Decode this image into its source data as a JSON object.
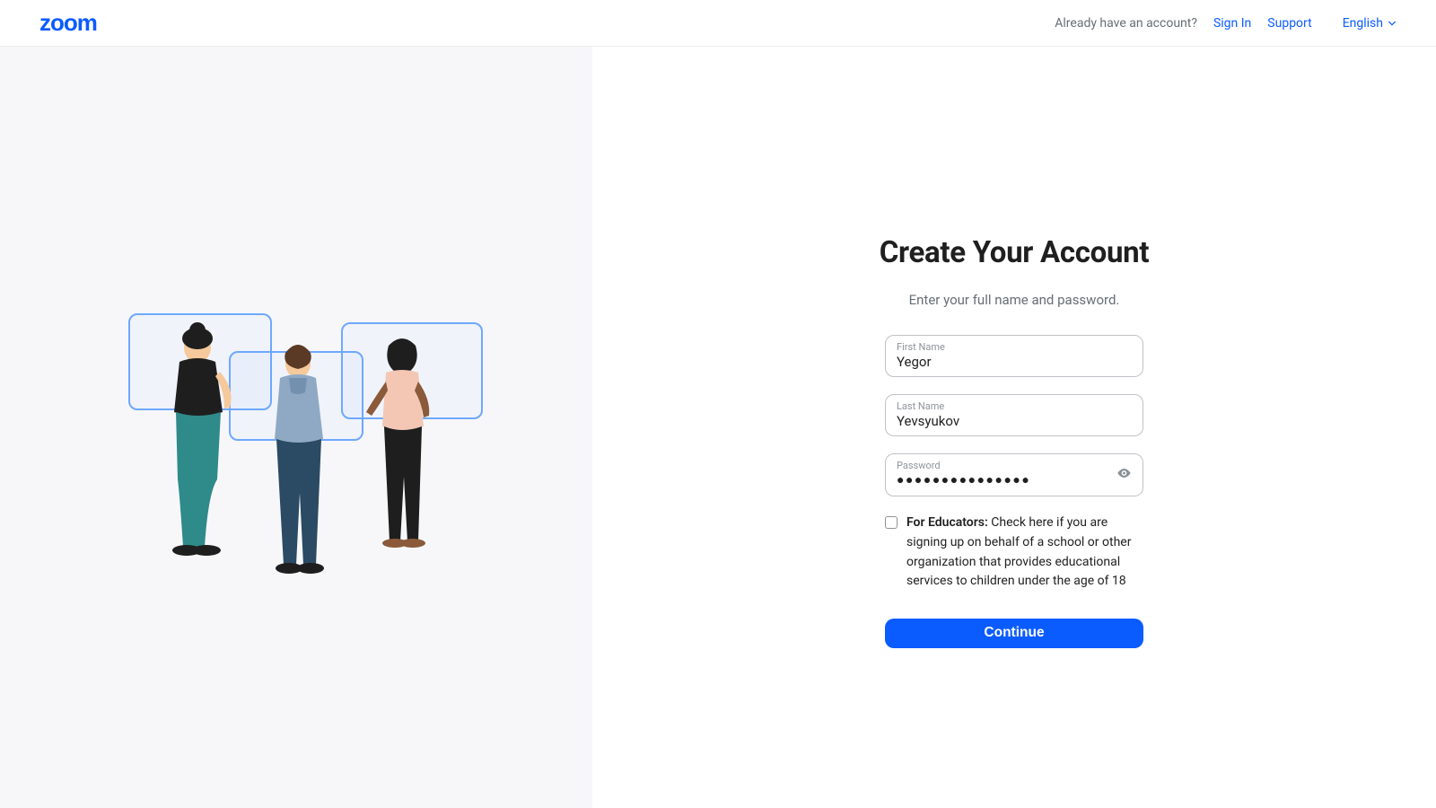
{
  "header": {
    "logo": "zoom",
    "already": "Already have an account?",
    "sign_in": "Sign In",
    "support": "Support",
    "language": "English"
  },
  "form": {
    "title": "Create Your Account",
    "subtitle": "Enter your full name and password.",
    "first_name_label": "First Name",
    "first_name_value": "Yegor",
    "last_name_label": "Last Name",
    "last_name_value": "Yevsyukov",
    "password_label": "Password",
    "password_mask": "●●●●●●●●●●●●●●●",
    "educators_bold": "For Educators:",
    "educators_text": " Check here if you are signing up on behalf of a school or other organization that provides educational services to children under the age of 18",
    "continue": "Continue"
  }
}
